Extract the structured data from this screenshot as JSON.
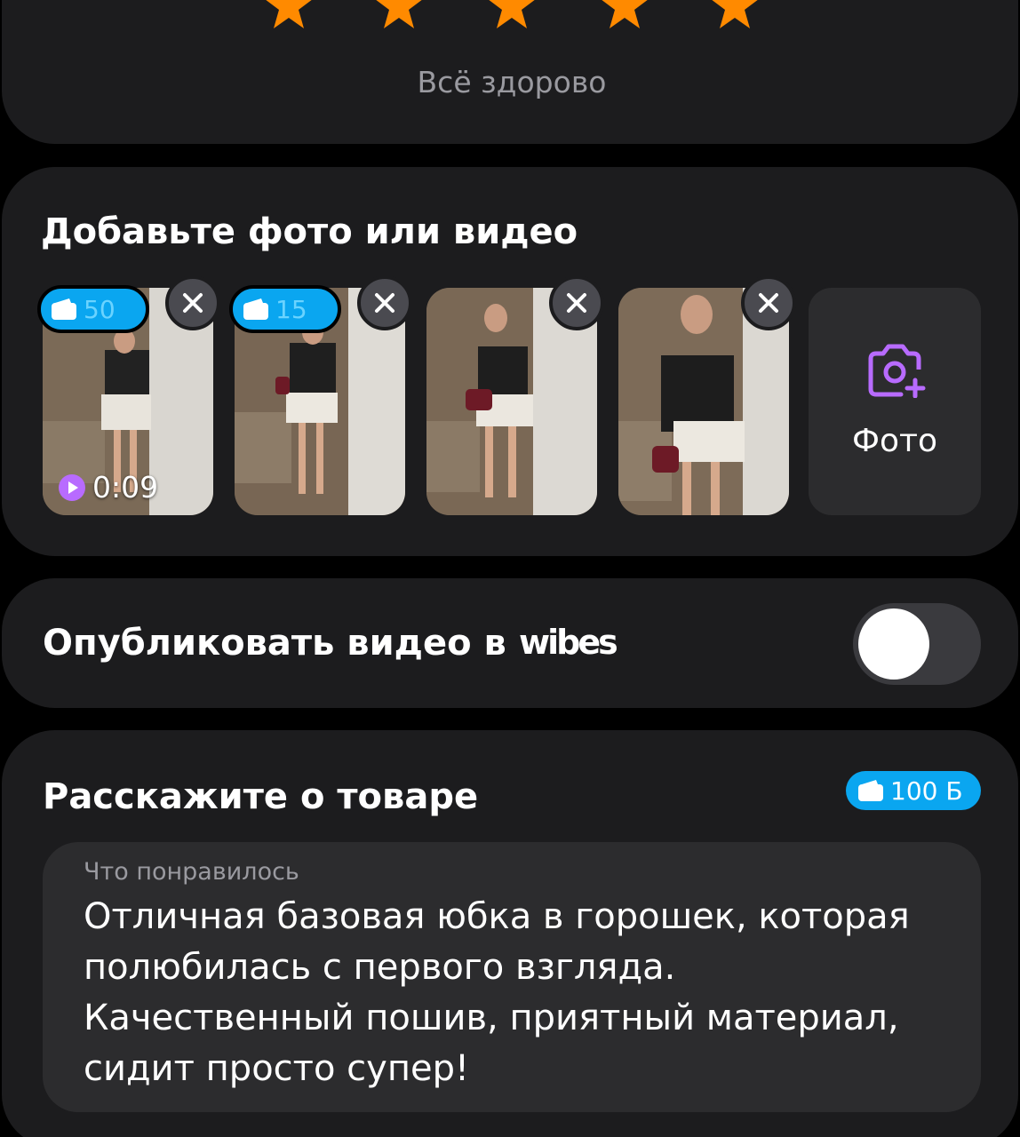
{
  "rating": {
    "stars": 5,
    "max_stars": 5,
    "caption": "Всё здорово",
    "star_color": "#ff8a00"
  },
  "media": {
    "title": "Добавьте фото или видео",
    "items": [
      {
        "type": "video",
        "bonus": "50",
        "duration": "0:09"
      },
      {
        "type": "photo",
        "bonus": "15"
      },
      {
        "type": "photo"
      },
      {
        "type": "photo"
      }
    ],
    "add_label": "Фото",
    "accent": "#b86bff"
  },
  "publish": {
    "label": "Опубликовать видео в",
    "brand": "wibes",
    "enabled": false
  },
  "review": {
    "title": "Расскажите о товаре",
    "points_badge": "100 Б",
    "field_label": "Что понравилось",
    "field_value": "Отличная базовая юбка в горошек, которая полюбилась с первого взгляда. Качественный пошив, приятный материал, сидит просто супер!"
  },
  "colors": {
    "background": "#000000",
    "card": "#1c1c1e",
    "badge": "#0aa6f0"
  }
}
